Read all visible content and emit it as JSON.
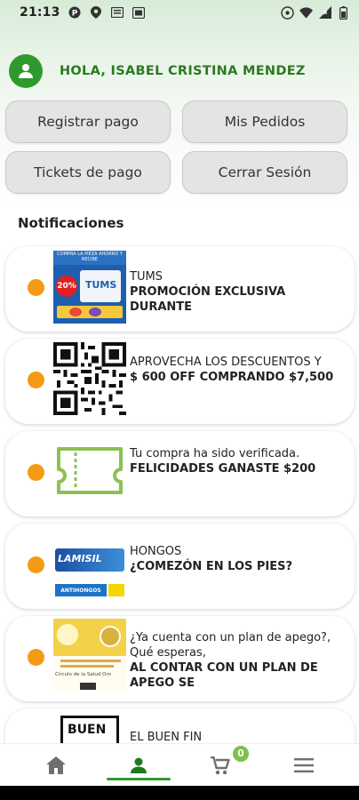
{
  "status_bar": {
    "time": "21:13",
    "left_icons": [
      "parking-icon",
      "location-icon",
      "email-icon",
      "gallery-icon"
    ],
    "right_icons": [
      "hotspot-icon",
      "wifi-icon",
      "signal-icon",
      "battery-icon"
    ]
  },
  "header": {
    "greeting": "HOLA, ISABEL CRISTINA MENDEZ",
    "avatar_icon": "person-icon"
  },
  "actions": {
    "register_payment": "Registrar pago",
    "my_orders": "Mis Pedidos",
    "payment_tickets": "Tickets de pago",
    "logout": "Cerrar Sesión"
  },
  "notifications": {
    "title": "Notificaciones",
    "items": [
      {
        "line1": "TUMS",
        "line2": "PROMOCIÓN EXCLUSIVA DURANTE",
        "thumb": "tums-promo-image"
      },
      {
        "line1": "APROVECHA LOS DESCUENTOS Y",
        "line2": "$ 600 OFF COMPRANDO $7,500",
        "thumb": "qr-code-image"
      },
      {
        "line1": "Tu compra ha sido verificada.",
        "line2": "FELICIDADES GANASTE $200",
        "thumb": "ticket-icon"
      },
      {
        "line1": "HONGOS",
        "line2": "¿COMEZÓN EN LOS PIES?",
        "thumb": "lamisil-product-image"
      },
      {
        "line1": "¿Ya cuenta con un plan de apego?, Qué esperas,",
        "line2": "AL CONTAR CON UN PLAN DE APEGO SE",
        "thumb": "circulo-salud-image"
      },
      {
        "line1": "EL BUEN FIN",
        "line2": "",
        "thumb": "buen-fin-image"
      }
    ],
    "thumb_texts": {
      "tums_headline": "COMPRA LA PIEZA AHORRO Y RECIBE",
      "tums_discount": "20%",
      "tums_brand": "TUMS",
      "lamisil_brand": "LAMISIL",
      "lamisil_tag": "ANTIHONGOS",
      "circulo_label": "Círculo de la Salud Oro",
      "buen_fin": "BUEN"
    }
  },
  "bottom_nav": {
    "items": [
      "home-icon",
      "profile-icon",
      "cart-icon",
      "menu-icon"
    ],
    "cart_count": "0",
    "active": "profile-icon"
  },
  "colors": {
    "brand_green": "#2e9a2e",
    "greeting_green": "#2c7a1f",
    "notification_dot": "#f59a14",
    "badge_green": "#7cc24a"
  }
}
